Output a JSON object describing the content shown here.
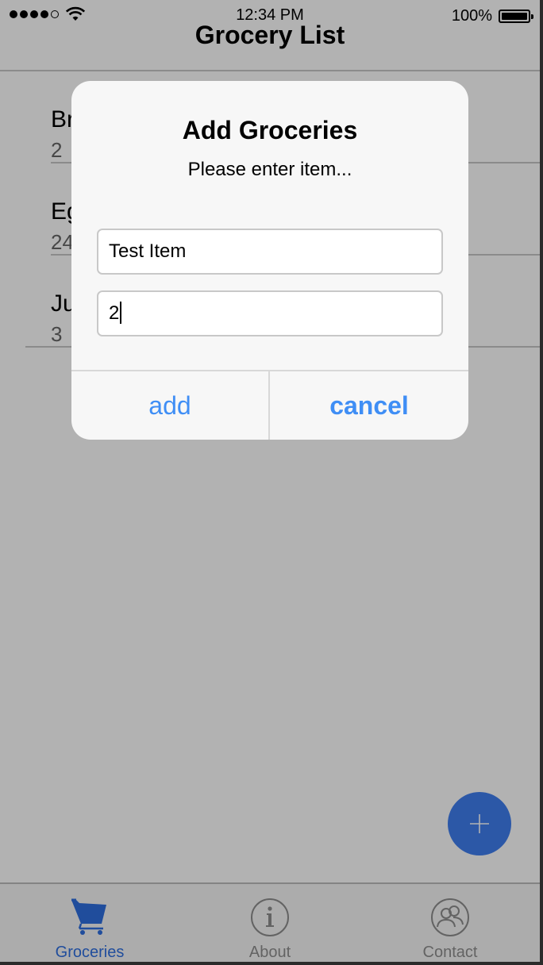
{
  "status_bar": {
    "time": "12:34 PM",
    "battery": "100%"
  },
  "header": {
    "title": "Grocery List"
  },
  "list": {
    "items": [
      {
        "name": "Bread",
        "qty": "2"
      },
      {
        "name": "Eggs",
        "qty": "24"
      },
      {
        "name": "Juice",
        "qty": "3"
      }
    ]
  },
  "dialog": {
    "title": "Add Groceries",
    "message": "Please enter item...",
    "item_value": "Test Item",
    "qty_value": "2",
    "add_label": "add",
    "cancel_label": "cancel"
  },
  "tabs": [
    {
      "label": "Groceries",
      "icon": "cart-icon",
      "active": true
    },
    {
      "label": "About",
      "icon": "info-icon",
      "active": false
    },
    {
      "label": "Contact",
      "icon": "contacts-icon",
      "active": false
    }
  ],
  "colors": {
    "accent": "#3f7ef0",
    "dialog_button": "#3f8ef5",
    "overlay": "rgba(0,0,0,0.30)"
  }
}
